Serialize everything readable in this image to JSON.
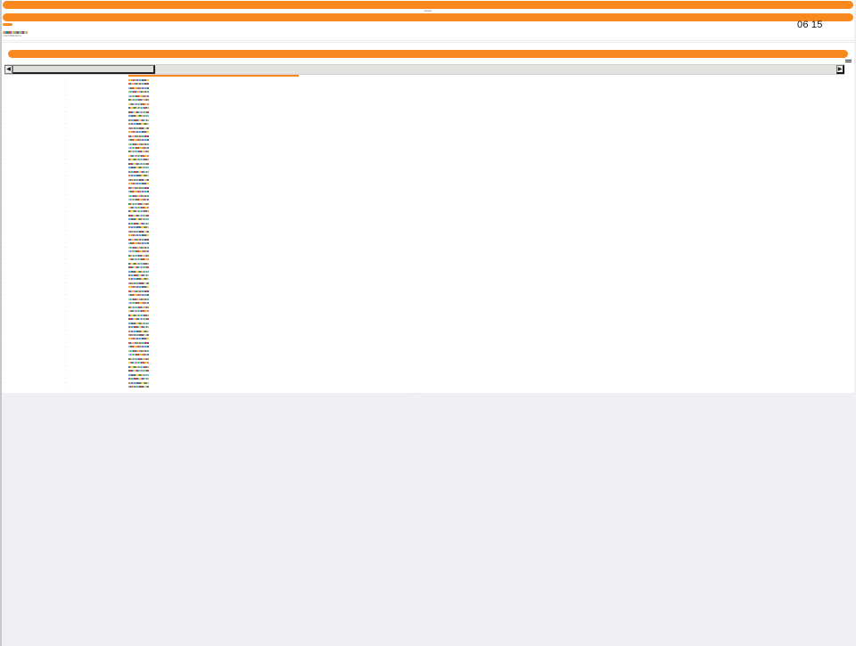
{
  "header": {
    "bar1_label": "Lorem",
    "bar2_label": "···",
    "clock": "06 15",
    "tiny_text": "1 34 5 5000   19   0.1"
  },
  "colors": {
    "accent": "#f7891f",
    "palette": [
      "#e8b04a",
      "#5fa2d9",
      "#3a8f5c",
      "#d9534f",
      "#8e6bb8",
      "#f0d24a",
      "#7ec4c1",
      "#c98b4a",
      "#4a6fa5",
      "#9fd16a",
      "#e27ab0",
      "#666666",
      "#b0c4de"
    ]
  },
  "icons": {
    "scroll_left": "scroll-left-icon",
    "scroll_right": "scroll-right-icon",
    "menu": "hamburger-menu-icon"
  },
  "table": {
    "rows": [
      [
        "····",
        "·····"
      ],
      [
        "····",
        "·····"
      ],
      [
        "····",
        "·····"
      ],
      [
        "····",
        "·····"
      ],
      [
        "····",
        "·····"
      ],
      [
        "····",
        "·····"
      ],
      [
        "····",
        "·····"
      ],
      [
        "····",
        "·····"
      ],
      [
        "····",
        "·····"
      ],
      [
        "····",
        "·····"
      ],
      [
        "····",
        "·····"
      ],
      [
        "····",
        "·····"
      ],
      [
        "····",
        "·····"
      ],
      [
        "····",
        "·····"
      ],
      [
        "····",
        "·····"
      ],
      [
        "····",
        "·····"
      ],
      [
        "····",
        "·····"
      ],
      [
        "····",
        "·····"
      ],
      [
        "····",
        "·····"
      ],
      [
        "····",
        "·····"
      ],
      [
        "····",
        "·····"
      ],
      [
        "····",
        "·····"
      ],
      [
        "····",
        "·····"
      ],
      [
        "····",
        "·····"
      ],
      [
        "····",
        "·····"
      ],
      [
        "····",
        "·····"
      ],
      [
        "····",
        "·····"
      ],
      [
        "····",
        "·····"
      ],
      [
        "····",
        "·····"
      ],
      [
        "····",
        "·····"
      ],
      [
        "····",
        "·····"
      ],
      [
        "····",
        "·····"
      ],
      [
        "····",
        "·····"
      ],
      [
        "····",
        "·····"
      ],
      [
        "····",
        "·····"
      ],
      [
        "····",
        "·····"
      ],
      [
        "····",
        "·····"
      ],
      [
        "····",
        "·····"
      ],
      [
        "····",
        "·····"
      ],
      [
        "····",
        "·····"
      ],
      [
        "····",
        "·····"
      ],
      [
        "····",
        "·····"
      ],
      [
        "····",
        "·····"
      ],
      [
        "····",
        "·····"
      ],
      [
        "····",
        "·····"
      ],
      [
        "····",
        "·····"
      ],
      [
        "····",
        "·····"
      ],
      [
        "····",
        "·····"
      ],
      [
        "····",
        "·····"
      ],
      [
        "····",
        "·····"
      ],
      [
        "····",
        "·····"
      ],
      [
        "····",
        "·····"
      ],
      [
        "····",
        "·····"
      ],
      [
        "····",
        "·····"
      ],
      [
        "····",
        "·····"
      ],
      [
        "····",
        "·····"
      ],
      [
        "····",
        "·····"
      ],
      [
        "····",
        "·····"
      ],
      [
        "····",
        "·····"
      ],
      [
        "····",
        "·····"
      ],
      [
        "····",
        "·····"
      ],
      [
        "····",
        "·····"
      ],
      [
        "····",
        "·····"
      ],
      [
        "····",
        "·····"
      ],
      [
        "····",
        "·····"
      ],
      [
        "····",
        "·····"
      ],
      [
        "····",
        "·····"
      ],
      [
        "····",
        "·····"
      ],
      [
        "····",
        "·····"
      ],
      [
        "····",
        "·····"
      ],
      [
        "····",
        "·····"
      ],
      [
        "····",
        "·····"
      ],
      [
        "····",
        "·····"
      ],
      [
        "····",
        "·····"
      ],
      [
        "····",
        "·····"
      ],
      [
        "····",
        "·····"
      ],
      [
        "····",
        "·····"
      ],
      [
        "····",
        "·····"
      ]
    ]
  },
  "footer": {
    "text": "·······    ······"
  }
}
